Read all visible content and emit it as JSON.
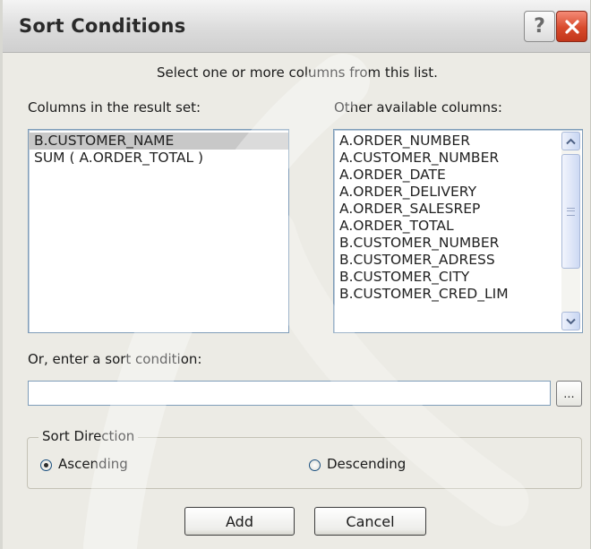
{
  "window": {
    "title": "Sort Conditions",
    "help_glyph": "?",
    "close_icon": "close-icon"
  },
  "instructions": "Select one or more columns from this list.",
  "result_set": {
    "label": "Columns in the result set:",
    "items": [
      "B.CUSTOMER_NAME",
      "SUM ( A.ORDER_TOTAL )"
    ],
    "selected_index": 0
  },
  "available": {
    "label": "Other available columns:",
    "items": [
      "A.ORDER_NUMBER",
      "A.CUSTOMER_NUMBER",
      "A.ORDER_DATE",
      "A.ORDER_DELIVERY",
      "A.ORDER_SALESREP",
      "A.ORDER_TOTAL",
      "B.CUSTOMER_NUMBER",
      "B.CUSTOMER_ADRESS",
      "B.CUSTOMER_CITY",
      "B.CUSTOMER_CRED_LIM"
    ]
  },
  "sort_condition": {
    "label": "Or, enter a sort condition:",
    "value": "",
    "browse_label": "..."
  },
  "sort_direction": {
    "legend": "Sort Direction",
    "ascending_label": "Ascending",
    "descending_label": "Descending",
    "selected": "Ascending"
  },
  "buttons": {
    "add_label": "Add",
    "cancel_label": "Cancel"
  },
  "colors": {
    "dialog_bg": "#ecebe5",
    "close_button": "#d84a2c",
    "selection_bg": "#c8c8c8"
  }
}
